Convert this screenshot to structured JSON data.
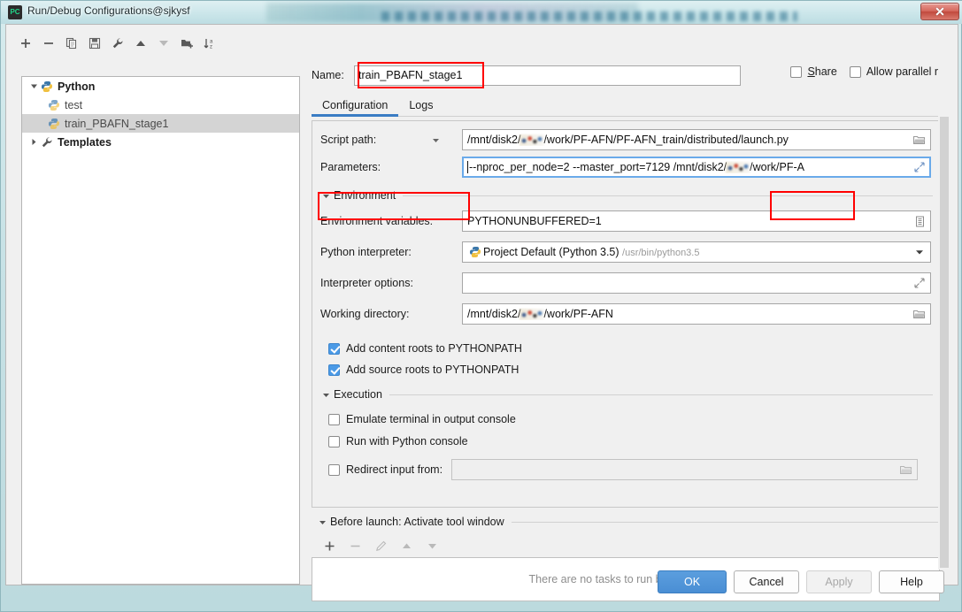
{
  "window": {
    "title": "Run/Debug Configurations@sjkysf",
    "app_icon": "PC",
    "close_label": "x"
  },
  "toolbar": {
    "items": [
      {
        "name": "add",
        "icon": "plus-icon",
        "enabled": true
      },
      {
        "name": "remove",
        "icon": "minus-icon",
        "enabled": true
      },
      {
        "name": "copy",
        "icon": "copy-icon",
        "enabled": true
      },
      {
        "name": "save",
        "icon": "save-icon",
        "enabled": true
      },
      {
        "name": "edit-templates",
        "icon": "wrench-icon",
        "enabled": true
      },
      {
        "name": "move-up",
        "icon": "arrow-up-icon",
        "enabled": true
      },
      {
        "name": "move-down",
        "icon": "arrow-down-icon",
        "enabled": false
      },
      {
        "name": "move-into-folder",
        "icon": "folder-add-icon",
        "enabled": true
      },
      {
        "name": "sort-alphabetically",
        "icon": "sort-az-icon",
        "enabled": true
      }
    ]
  },
  "tree": {
    "nodes": [
      {
        "label": "Python",
        "icon": "python-icon",
        "bold": true,
        "expanded": true,
        "level": 0,
        "selected": false
      },
      {
        "label": "test",
        "icon": "python-icon",
        "bold": false,
        "level": 1,
        "selected": false
      },
      {
        "label": "train_PBAFN_stage1",
        "icon": "python-icon",
        "bold": false,
        "level": 1,
        "selected": true
      },
      {
        "label": "Templates",
        "icon": "wrench-icon",
        "bold": true,
        "expanded": false,
        "level": 0,
        "selected": false
      }
    ]
  },
  "name_field": {
    "label": "Name:",
    "value": "train_PBAFN_stage1",
    "highlighted": true
  },
  "options": {
    "share": {
      "label": "Share",
      "accel": "S",
      "checked": false
    },
    "allow_parallel_run": {
      "label": "Allow parallel run",
      "accel": "u",
      "checked": false
    }
  },
  "tabs": [
    {
      "label": "Configuration",
      "active": true
    },
    {
      "label": "Logs",
      "active": false
    }
  ],
  "configuration": {
    "script_path": {
      "label": "Script path:",
      "value_prefix": "/mnt/disk2/",
      "value_suffix": "/work/PF-AFN/PF-AFN_train/distributed/launch.py",
      "redacted": true,
      "highlighted": true,
      "browse_icon": "folder-open-icon"
    },
    "parameters": {
      "label": "Parameters:",
      "value": "--nproc_per_node=2 --master_port=7129 /mnt/disk2/",
      "value_tail": "/work/PF-A",
      "redacted": true,
      "focused": true,
      "expand_icon": "expand-icon"
    },
    "environment": {
      "section_label": "Environment",
      "expanded": true,
      "environment_variables": {
        "label": "Environment variables:",
        "value": "PYTHONUNBUFFERED=1",
        "edit_icon": "list-edit-icon"
      },
      "python_interpreter": {
        "label": "Python interpreter:",
        "value": "Project Default (Python 3.5)",
        "value_hint": "/usr/bin/python3.5",
        "icon": "python-icon",
        "dropdown_icon": "chevron-down-icon"
      },
      "interpreter_options": {
        "label": "Interpreter options:",
        "value": "",
        "expand_icon": "expand-icon"
      },
      "working_directory": {
        "label": "Working directory:",
        "value_prefix": "/mnt/disk2/",
        "value_suffix": "/work/PF-AFN",
        "redacted": true,
        "browse_icon": "folder-open-icon"
      },
      "add_content_roots": {
        "label": "Add content roots to PYTHONPATH",
        "checked": true
      },
      "add_source_roots": {
        "label": "Add source roots to PYTHONPATH",
        "checked": true
      }
    },
    "execution": {
      "section_label": "Execution",
      "expanded": true,
      "emulate_terminal": {
        "label": "Emulate terminal in output console",
        "checked": false
      },
      "run_with_python_console": {
        "label": "Run with Python console",
        "checked": false
      },
      "redirect_input": {
        "label": "Redirect input from:",
        "checked": false,
        "value": "",
        "disabled": true,
        "browse_icon": "folder-open-icon"
      }
    }
  },
  "before_launch": {
    "section_label": "Before launch: Activate tool window",
    "expanded": true,
    "toolbar": [
      {
        "name": "add-task",
        "icon": "plus-icon",
        "enabled": true
      },
      {
        "name": "remove-task",
        "icon": "minus-icon",
        "enabled": false
      },
      {
        "name": "edit-task",
        "icon": "pencil-icon",
        "enabled": false
      },
      {
        "name": "move-task-up",
        "icon": "arrow-up-icon",
        "enabled": false
      },
      {
        "name": "move-task-down",
        "icon": "arrow-down-icon",
        "enabled": false
      }
    ],
    "empty_text": "There are no tasks to run before launch"
  },
  "buttons": {
    "ok": {
      "label": "OK",
      "primary": true,
      "enabled": true
    },
    "cancel": {
      "label": "Cancel",
      "enabled": true
    },
    "apply": {
      "label": "Apply",
      "enabled": false
    },
    "help": {
      "label": "Help",
      "enabled": true
    }
  },
  "colors": {
    "accent": "#3a7cc4",
    "primary_button": "#4a8ed4",
    "highlight_box": "#ff0000",
    "selection": "#d4d4d4",
    "titlebar": "#cbe6ea"
  }
}
